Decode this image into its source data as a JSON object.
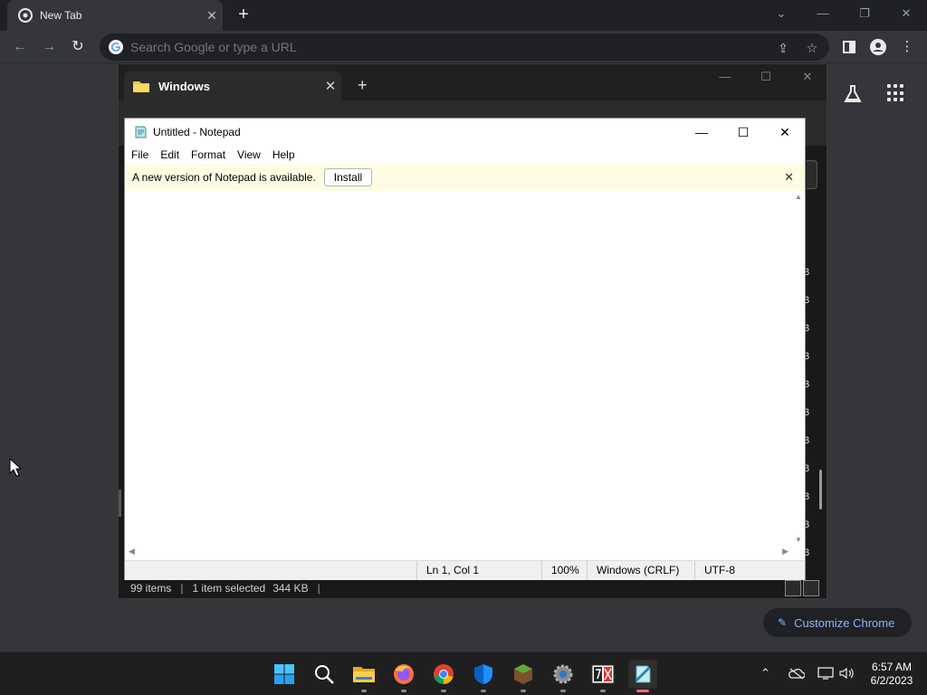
{
  "chrome": {
    "tab_title": "New Tab",
    "tab_close": "✕",
    "new_tab": "+",
    "window_controls": [
      "⌄",
      "—",
      "❐",
      "✕"
    ],
    "omnibox_placeholder": "Search Google or type a URL",
    "customize_label": "Customize Chrome",
    "nav_back": "←",
    "nav_forward": "→",
    "nav_reload": "↻",
    "accent_color": "#8ab4f8"
  },
  "explorer": {
    "tab_title": "Windows",
    "tab_close": "✕",
    "new_tab": "+",
    "window_controls": [
      "—",
      "☐",
      "✕"
    ],
    "list_suffixes": [
      "B",
      "B",
      "B",
      "B",
      "B",
      "B",
      "B",
      "B",
      "B",
      "B",
      "B"
    ],
    "status": {
      "items": "99 items",
      "selected": "1 item selected",
      "size": "344 KB"
    }
  },
  "notepad": {
    "title": "Untitled - Notepad",
    "window_controls": [
      "—",
      "☐",
      "✕"
    ],
    "menu": [
      "File",
      "Edit",
      "Format",
      "View",
      "Help"
    ],
    "info_message": "A new version of Notepad is available.",
    "install_label": "Install",
    "info_close": "✕",
    "content": "",
    "status": {
      "position": "Ln 1, Col 1",
      "zoom": "100%",
      "line_ending": "Windows (CRLF)",
      "encoding": "UTF-8"
    }
  },
  "taskbar": {
    "apps": [
      "start-icon",
      "search-icon",
      "file-explorer-icon",
      "firefox-icon",
      "chrome-icon",
      "defender-icon",
      "minecraft-icon",
      "settings-icon",
      "7zip-icon",
      "notepad-icon"
    ],
    "time": "6:57 AM",
    "date": "6/2/2023"
  }
}
